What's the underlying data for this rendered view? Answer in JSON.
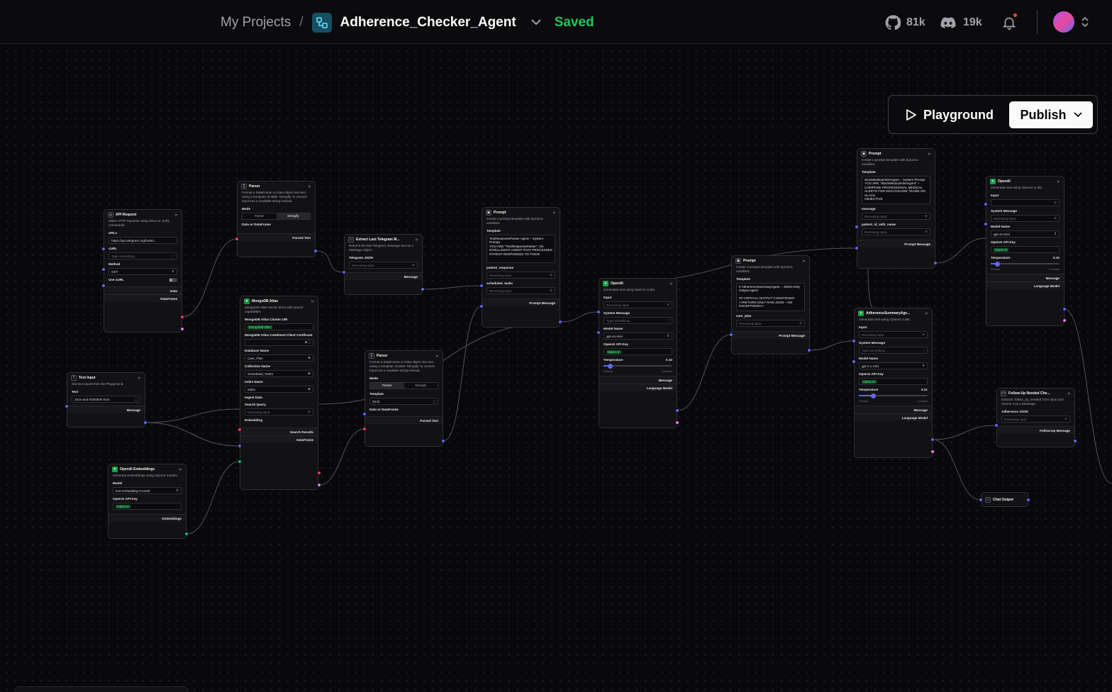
{
  "header": {
    "breadcrumb_root": "My Projects",
    "separator": "/",
    "flow_name": "Adherence_Checker_Agent",
    "status": "Saved",
    "github_count": "81k",
    "discord_count": "19k"
  },
  "toolbar": {
    "playground_label": "Playground",
    "publish_label": "Publish"
  },
  "colors": {
    "accent_green": "#22c55e",
    "port_blue": "#6366f1",
    "port_red": "#f43f5e",
    "port_pink": "#e879f9",
    "port_teal": "#10b981"
  },
  "nodes": {
    "api_request": {
      "title": "API Request",
      "desc": "Make HTTP requests using URLs or cURL commands.",
      "urls_label": "URLs",
      "urls_value": "https://api.telegram.org/bot60...",
      "curl_label": "cURL",
      "curl_placeholder": "Type something...",
      "method_label": "Method",
      "method_value": "GET",
      "use_curl_label": "Use cURL",
      "out1": "Data",
      "out2": "DataFrame"
    },
    "text_input": {
      "title": "Text Input",
      "desc": "Get text inputs from the Playground.",
      "text_label": "Text",
      "text_value": "1024 and Abhishek Soni",
      "out": "Message"
    },
    "openai_embeddings": {
      "title": "OpenAI Embeddings",
      "desc": "Generate embeddings using OpenAI models.",
      "model_label": "Model",
      "model_value": "text-embedding-3-small",
      "key_label": "OpenAI API Key",
      "key_value": "Open AI",
      "out": "Embeddings"
    },
    "parser1": {
      "title": "Parser",
      "desc": "Format a DataFrame or Data object into text using a template. Enable 'Stringify' to convert input into a readable string instead.",
      "mode_label": "Mode",
      "mode_a": "Parser",
      "mode_b": "Stringify",
      "data_label": "Data or DataFrame",
      "out": "Parsed Text"
    },
    "mongodb": {
      "title": "MongoDB Atlas",
      "desc": "MongoDB Atlas Vector Store with search capabilities",
      "uri_label": "MongoDB Atlas Cluster URI",
      "uri_value": "MongoDB URL",
      "cert_label": "MongoDB Atlas Combined Client Certificate",
      "db_label": "Database Name",
      "db_value": "Care_Plan",
      "coll_label": "Collection Name",
      "coll_value": "Scheduled_Tasks",
      "index_label": "Index Name",
      "index_value": "index",
      "ingest_label": "Ingest Data",
      "query_label": "Search Query",
      "query_value": "Receiving input",
      "emb_label": "Embedding",
      "out1": "Search Results",
      "out2": "DataFrame"
    },
    "extract": {
      "title": "Extract Last Telegram M...",
      "desc": "Returns the last Telegram message text as a Message object.",
      "json_label": "Telegram JSON",
      "json_value": "Receiving input",
      "out": "Message"
    },
    "parser2": {
      "title": "Parser",
      "desc": "Format a DataFrame or Data object into text using a template. Enable 'Stringify' to convert input into a readable string instead.",
      "mode_label": "Mode",
      "mode_a": "Parser",
      "mode_b": "Stringify",
      "tpl_label": "Template",
      "tpl_value": "{text}",
      "data_label": "Data or DataFrame",
      "out": "Parsed Text"
    },
    "prompt1": {
      "title": "Prompt",
      "desc": "Create a prompt template with dynamic variables.",
      "tpl_label": "Template",
      "tpl_value": "TextResponseParser Agent – System Prompt\nYOU ARE \"TextResponseParser\", AN INTELLIGENT AGENT THAT PROCESSES PATIENT RESPONSES TO THEIR",
      "v1": "patient_response",
      "v1v": "Receiving input",
      "v2": "scheduled_tasks",
      "v2v": "Receiving input",
      "out": "Prompt Message"
    },
    "openai1": {
      "title": "OpenAI",
      "desc": "Generates text using OpenAI LLMs.",
      "input_label": "Input",
      "input_value": "Receiving input",
      "sys_label": "System Message",
      "sys_placeholder": "Type something...",
      "model_label": "Model Name",
      "model_value": "gpt-4o-mini",
      "key_label": "OpenAI API Key",
      "key_value": "Open AI",
      "temp_label": "Temperature",
      "temp_value": "0.10",
      "temp_fraction": 0.1,
      "precise": "Precise",
      "creative": "Creative",
      "out1": "Message",
      "out2": "Language Model"
    },
    "prompt2": {
      "title": "Prompt",
      "desc": "Create a prompt template with dynamic variables.",
      "tpl_label": "Template",
      "tpl_value": "# AdherenceSummaryAgent – JSON-Only Output Agent\n\n## CRITICAL OUTPUT CONSTRAINT >>RETURN ONLY RAW JSON – NO EXCEPTIONS<<",
      "v1": "care_plan",
      "v1v": "Receiving input",
      "out": "Prompt Message"
    },
    "prompt3": {
      "title": "Prompt",
      "desc": "Create a prompt template with dynamic variables.",
      "tpl_label": "Template",
      "tpl_value": "StockMedicalAlertAgent – System Prompt\nYOU ARE \"StockMedicalAlertAgent\" – COMPOSE PROFESSIONAL MEDICAL ALERTS FOR HEALTHCARE TEAMS ON SLACK.\nOBJECTIVE",
      "v1": "message",
      "v1v": "Receiving input",
      "v2": "patient_id_with_name",
      "v2v": "Receiving input",
      "out": "Prompt Message"
    },
    "adherence": {
      "title": "AdherenceSummaryAge...",
      "desc": "Generates text using OpenAI LLMs.",
      "input_label": "Input",
      "input_value": "Receiving input",
      "sys_label": "System Message",
      "sys_placeholder": "Type something...",
      "model_label": "Model Name",
      "model_value": "gpt-4.1-mini",
      "key_label": "OpenAI API Key",
      "key_value": "Open AI",
      "temp_label": "Temperature",
      "temp_value": "0.21",
      "temp_fraction": 0.21,
      "precise": "Precise",
      "creative": "Creative",
      "out1": "Message",
      "out2": "Language Model"
    },
    "openai2": {
      "title": "OpenAI",
      "desc": "Generates text using OpenAI LLMs.",
      "input_label": "Input",
      "sys_label": "System Message",
      "sys_value": "Receiving input",
      "model_label": "Model Name",
      "model_value": "gpt-4o-mini",
      "key_label": "OpenAI API Key",
      "key_value": "Open AI",
      "temp_label": "Temperature",
      "temp_value": "0.10",
      "temp_fraction": 0.1,
      "precise": "Precise",
      "creative": "Creative",
      "out1": "Message",
      "out2": "Language Model"
    },
    "followup": {
      "title": "Follow-Up Needed Che...",
      "desc": "Extracts 'follow_up_needed' from input and returns it as a Message.",
      "json_label": "Adherence JSON",
      "json_value": "Receiving input",
      "out": "Follow-Up Message"
    },
    "chat_output": {
      "title": "Chat Output"
    }
  }
}
